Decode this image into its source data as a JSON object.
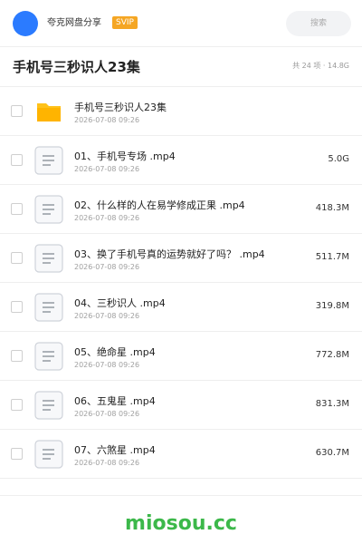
{
  "header": {
    "brand": "夸克网盘分享",
    "badge": "SVIP",
    "search_placeholder": "搜索"
  },
  "folder": {
    "title": "手机号三秒识人23集",
    "meta": "共 24 项 · 14.8G"
  },
  "files": [
    {
      "type": "folder",
      "name": "手机号三秒识人23集",
      "date": "2026-07-08 09:26",
      "size": ""
    },
    {
      "type": "file",
      "name": "01、手机号专场 .mp4",
      "date": "2026-07-08 09:26",
      "size": "5.0G"
    },
    {
      "type": "file",
      "name": "02、什么样的人在易学修成正果 .mp4",
      "date": "2026-07-08 09:26",
      "size": "418.3M"
    },
    {
      "type": "file",
      "name": "03、换了手机号真的运势就好了吗？ .mp4",
      "date": "2026-07-08 09:26",
      "size": "511.7M"
    },
    {
      "type": "file",
      "name": "04、三秒识人 .mp4",
      "date": "2026-07-08 09:26",
      "size": "319.8M"
    },
    {
      "type": "file",
      "name": "05、绝命星 .mp4",
      "date": "2026-07-08 09:26",
      "size": "772.8M"
    },
    {
      "type": "file",
      "name": "06、五鬼星 .mp4",
      "date": "2026-07-08 09:26",
      "size": "831.3M"
    },
    {
      "type": "file",
      "name": "07、六煞星 .mp4",
      "date": "2026-07-08 09:26",
      "size": "630.7M"
    }
  ],
  "footer": {
    "watermark": "miosou.cc"
  },
  "colors": {
    "avatar": "#2b7bff",
    "badge": "#f5a623",
    "folder_icon": "#ffc21a",
    "watermark": "#3cb84a"
  },
  "icons": {
    "folder": "folder-icon",
    "file": "document-icon"
  }
}
